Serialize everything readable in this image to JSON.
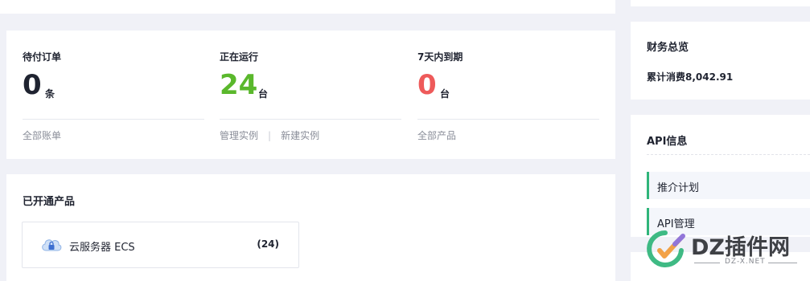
{
  "stats": [
    {
      "title": "待付订单",
      "value": "0",
      "unit": "条",
      "color": "#1f2330",
      "links": [
        "全部账单"
      ]
    },
    {
      "title": "正在运行",
      "value": "24",
      "unit": "台",
      "color": "#5ab82c",
      "links": [
        "管理实例",
        "新建实例"
      ],
      "separator": "|"
    },
    {
      "title": "7天内到期",
      "value": "0",
      "unit": "台",
      "color": "#ee5a5a",
      "links": [
        "全部产品"
      ]
    }
  ],
  "products": {
    "title": "已开通产品",
    "items": [
      {
        "name": "云服务器 ECS",
        "count": "(24)",
        "icon": "cloud-server-icon"
      }
    ]
  },
  "finance": {
    "title": "财务总览",
    "amount_text": "累计消费8,042.91"
  },
  "api": {
    "title": "API信息",
    "items": [
      "推介计划",
      "API管理"
    ]
  },
  "watermark": {
    "text": "DZ插件网",
    "sub": "DZ-X.NET",
    "colors": {
      "accent": "#2fb57a",
      "orange": "#f29b38",
      "purple": "#8a6bd6"
    }
  }
}
